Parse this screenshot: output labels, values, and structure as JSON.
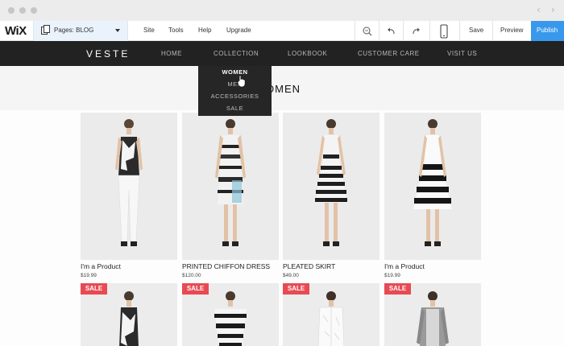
{
  "toolbar": {
    "logo": "WiX",
    "pages_label": "Pages: BLOG",
    "menu": [
      "Site",
      "Tools",
      "Help",
      "Upgrade"
    ],
    "save": "Save",
    "preview": "Preview",
    "publish": "Publish"
  },
  "site": {
    "brand": "VESTE",
    "nav": [
      "HOME",
      "COLLECTION",
      "LOOKBOOK",
      "CUSTOMER CARE",
      "VISIT US"
    ],
    "dropdown": [
      "WOMEN",
      "MEN",
      "ACCESSORIES",
      "SALE"
    ],
    "page_title_partial": "OMEN"
  },
  "products": [
    {
      "name": "I'm a Product",
      "price": "$19.99"
    },
    {
      "name": "PRINTED CHIFFON DRESS",
      "price": "$120.00"
    },
    {
      "name": "PLEATED SKIRT",
      "price": "$49.00"
    },
    {
      "name": "I'm a Product",
      "price": "$19.99"
    }
  ],
  "sale_badge": "SALE",
  "colors": {
    "publish": "#3899ec",
    "header": "#222222",
    "sale": "#e84a53"
  }
}
